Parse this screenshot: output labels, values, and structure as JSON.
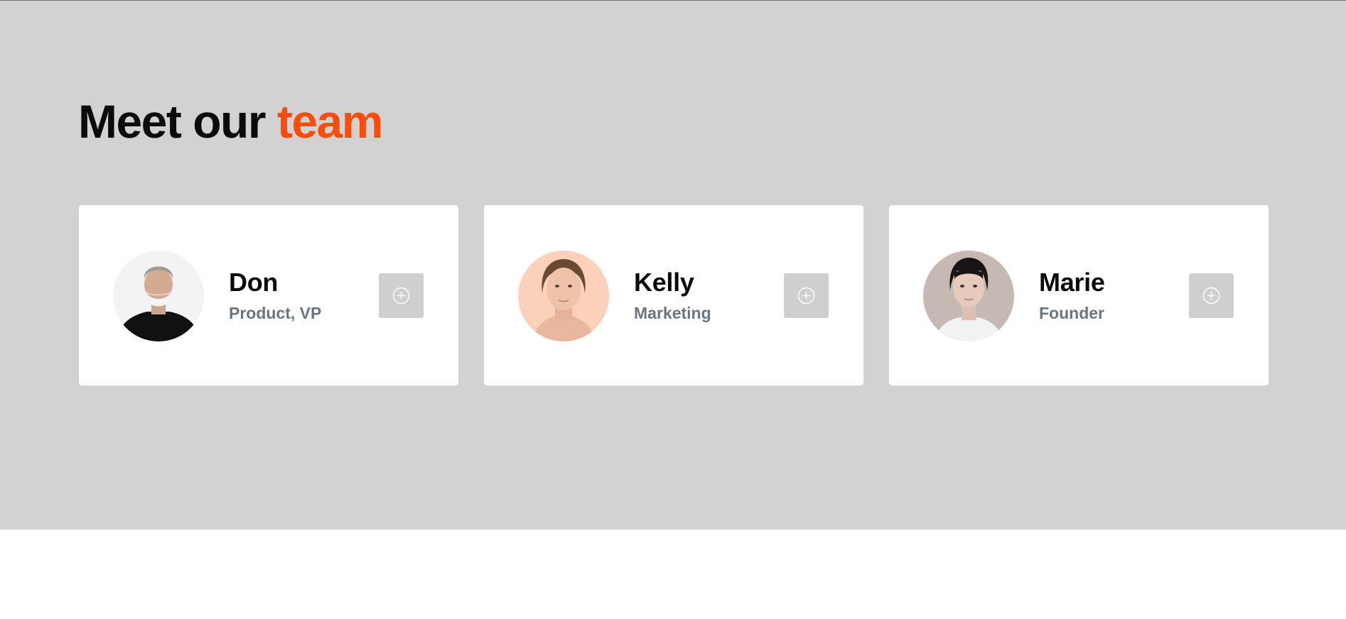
{
  "heading": {
    "prefix": "Meet our",
    "accent": "team"
  },
  "colors": {
    "accent": "#fc4c0c",
    "section_background": "#d1d2d1",
    "card_background": "#ffffff",
    "role_text": "#6b7580",
    "button_background": "#cfcfcf"
  },
  "team": [
    {
      "name": "Don",
      "role": "Product, VP",
      "avatar_icon": "person-avatar-man-face-mask",
      "action_icon": "plus-circle-icon"
    },
    {
      "name": "Kelly",
      "role": "Marketing",
      "avatar_icon": "person-avatar-woman",
      "action_icon": "plus-circle-icon"
    },
    {
      "name": "Marie",
      "role": "Founder",
      "avatar_icon": "person-avatar-woman-dark-hair",
      "action_icon": "plus-circle-icon"
    }
  ]
}
